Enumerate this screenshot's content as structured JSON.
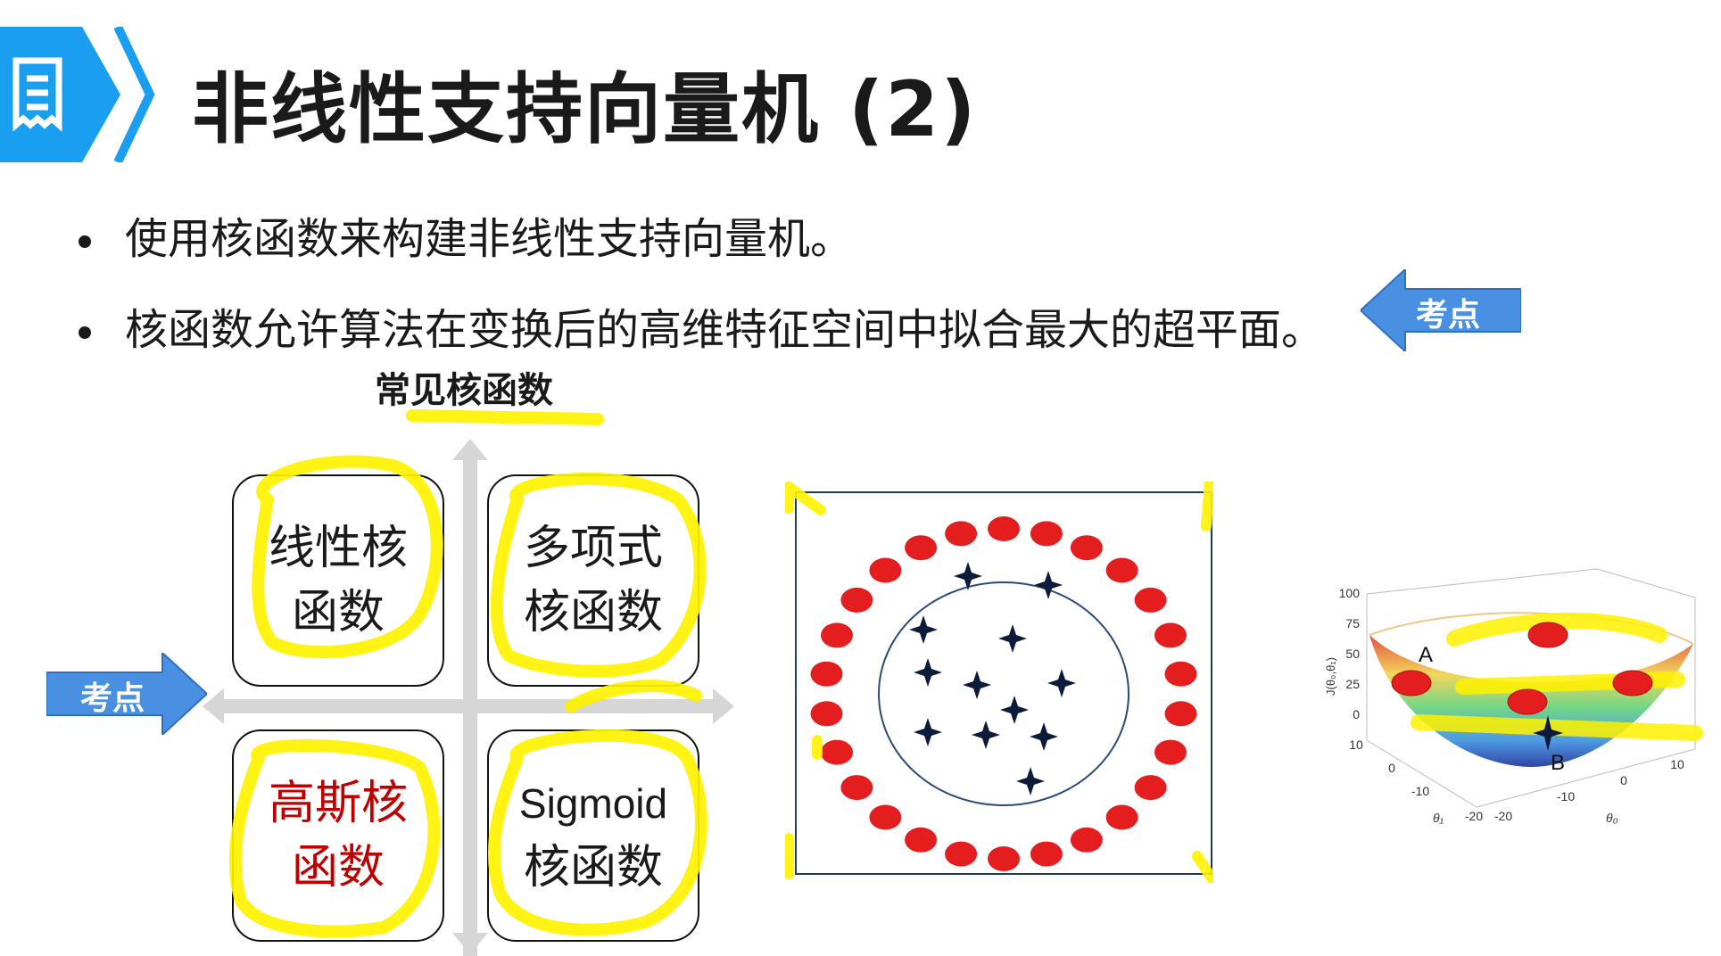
{
  "slide": {
    "title": "非线性支持向量机 (2)",
    "accent_color": "#1a9ef0",
    "header_icon": "receipt-document-icon"
  },
  "bullets": [
    {
      "text": "使用核函数来构建非线性支持向量机。"
    },
    {
      "text": "核函数允许算法在变换后的高维特征空间中拟合最大的超平面。"
    }
  ],
  "exam_tags": {
    "label": "考点",
    "color": "#4a90e2",
    "bullet_tag_label": "考点",
    "quadrant_tag_label": "考点"
  },
  "kernels": {
    "title": "常见核函数",
    "items": [
      {
        "line1": "线性核",
        "line2": "函数"
      },
      {
        "line1": "多项式",
        "line2": "核函数"
      },
      {
        "line1": "高斯核",
        "line2": "函数",
        "color": "#c00000"
      },
      {
        "line1": "Sigmoid",
        "line2": "核函数"
      }
    ]
  },
  "surface_plot": {
    "z_ticks": [
      "100",
      "75",
      "50",
      "25",
      "0"
    ],
    "z_label": "J(θ₀,θ₁)",
    "theta1_ticks": [
      "10",
      "0",
      "-10",
      "-20"
    ],
    "theta0_ticks": [
      "10",
      "0",
      "-10",
      "-20"
    ],
    "theta1_label": "θ₁",
    "theta0_label": "θ₀",
    "point_a": "A",
    "point_b": "B"
  },
  "highlight_color": "#fff200"
}
